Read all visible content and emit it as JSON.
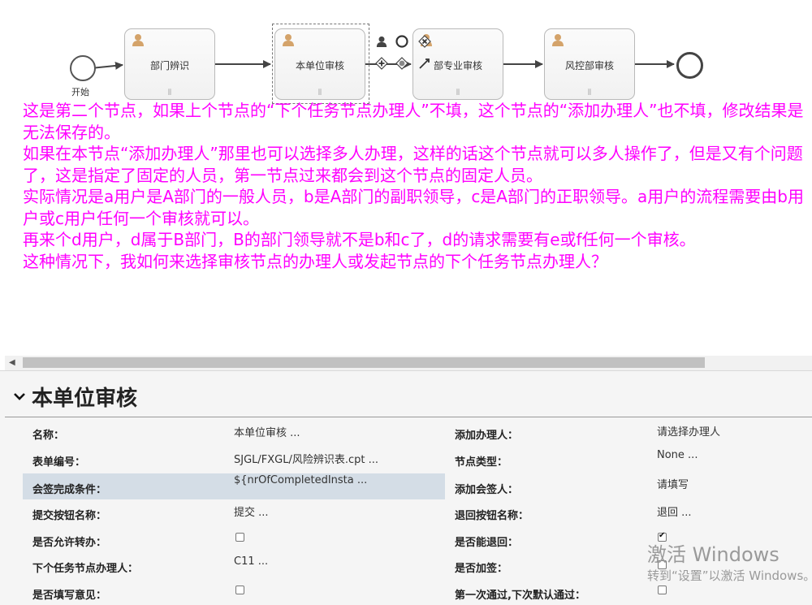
{
  "diagram": {
    "start_label": "开始",
    "tasks": [
      {
        "id": "t1",
        "label": "部门辨识"
      },
      {
        "id": "t2",
        "label": "本单位审核"
      },
      {
        "id": "t3",
        "label": "部专业审核"
      },
      {
        "id": "t4",
        "label": "风控部审核"
      }
    ],
    "multi_instance_marker": "⫴"
  },
  "note": {
    "paragraphs": [
      "这是第二个节点，如果上个节点的“下个任务节点办理人”不填，这个节点的“添加办理人”也不填，修改结果是无法保存的。",
      "如果在本节点“添加办理人”那里也可以选择多人办理，这样的话这个节点就可以多人操作了，但是又有个问题了，这是指定了固定的人员，第一节点过来都会到这个节点的固定人员。",
      "实际情况是a用户是A部门的一般人员，b是A部门的副职领导，c是A部门的正职领导。a用户的流程需要由b用户或c用户任何一个审核就可以。",
      "再来个d用户，d属于B部门，B的部门领导就不是b和c了，d的请求需要有e或f任何一个审核。",
      "",
      "这种情况下，我如何来选择审核节点的办理人或发起节点的下个任务节点办理人？"
    ]
  },
  "properties": {
    "title": "本单位审核",
    "left": [
      {
        "label": "名称：",
        "value": "本单位审核 ..."
      },
      {
        "label": "表单编号：",
        "value": "SJGL/FXGL/风险辨识表.cpt ..."
      },
      {
        "label": "会签完成条件：",
        "value": "${nrOfCompletedInsta ..."
      },
      {
        "label": "提交按钮名称：",
        "value": "提交 ..."
      },
      {
        "label": "是否允许转办：",
        "checked": false
      },
      {
        "label": "下个任务节点办理人：",
        "value": "C11 ..."
      },
      {
        "label": "是否填写意见：",
        "checked": false
      }
    ],
    "right": [
      {
        "label": "添加办理人：",
        "value": "请选择办理人"
      },
      {
        "label": "节点类型：",
        "value": "None ..."
      },
      {
        "label": "添加会签人：",
        "value": "请填写"
      },
      {
        "label": "退回按钮名称：",
        "value": "退回 ..."
      },
      {
        "label": "是否能退回：",
        "checked": true
      },
      {
        "label": "是否加签：",
        "checked": false
      },
      {
        "label": "第一次通过,下次默认通过：",
        "checked": false
      }
    ]
  },
  "watermark": {
    "line1": "激活 Windows",
    "line2": "转到“设置”以激活 Windows。"
  },
  "colors": {
    "note_text": "#ff00ff",
    "selected_row": "#d4dde6",
    "user_icon": "#d4a36a"
  }
}
